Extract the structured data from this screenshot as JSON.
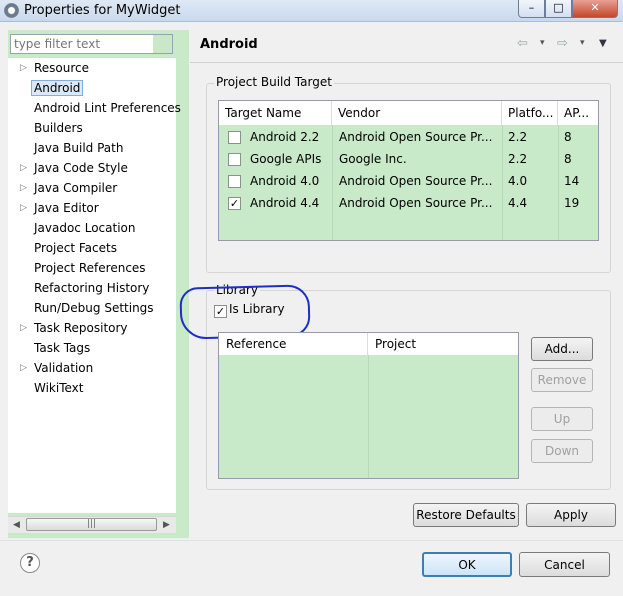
{
  "window": {
    "title": "Properties for MyWidget"
  },
  "filter": {
    "placeholder": "type filter text"
  },
  "tree": {
    "items": [
      {
        "label": "Resource",
        "expandable": true
      },
      {
        "label": "Android",
        "expandable": false,
        "selected": true
      },
      {
        "label": "Android Lint Preferences",
        "expandable": false
      },
      {
        "label": "Builders",
        "expandable": false
      },
      {
        "label": "Java Build Path",
        "expandable": false
      },
      {
        "label": "Java Code Style",
        "expandable": true
      },
      {
        "label": "Java Compiler",
        "expandable": true
      },
      {
        "label": "Java Editor",
        "expandable": true
      },
      {
        "label": "Javadoc Location",
        "expandable": false
      },
      {
        "label": "Project Facets",
        "expandable": false
      },
      {
        "label": "Project References",
        "expandable": false
      },
      {
        "label": "Refactoring History",
        "expandable": false
      },
      {
        "label": "Run/Debug Settings",
        "expandable": false
      },
      {
        "label": "Task Repository",
        "expandable": true
      },
      {
        "label": "Task Tags",
        "expandable": false
      },
      {
        "label": "Validation",
        "expandable": true
      },
      {
        "label": "WikiText",
        "expandable": false
      }
    ]
  },
  "page": {
    "title": "Android"
  },
  "build_target": {
    "group_title": "Project Build Target",
    "columns": [
      "Target Name",
      "Vendor",
      "Platfo...",
      "AP..."
    ],
    "rows": [
      {
        "checked": false,
        "name": "Android 2.2",
        "vendor": "Android Open Source Pr...",
        "platform": "2.2",
        "api": "8"
      },
      {
        "checked": false,
        "name": "Google APIs",
        "vendor": "Google Inc.",
        "platform": "2.2",
        "api": "8"
      },
      {
        "checked": false,
        "name": "Android 4.0",
        "vendor": "Android Open Source Pr...",
        "platform": "4.0",
        "api": "14"
      },
      {
        "checked": true,
        "name": "Android 4.4",
        "vendor": "Android Open Source Pr...",
        "platform": "4.4",
        "api": "19"
      }
    ]
  },
  "library": {
    "group_title": "Library",
    "is_library_label": "Is Library",
    "is_library_checked": true,
    "columns": [
      "Reference",
      "Project"
    ],
    "buttons": {
      "add": "Add...",
      "remove": "Remove",
      "up": "Up",
      "down": "Down"
    }
  },
  "actions": {
    "restore_defaults": "Restore Defaults",
    "apply": "Apply",
    "ok": "OK",
    "cancel": "Cancel"
  },
  "icons": {
    "check": "✓",
    "help": "?",
    "expand": "▷",
    "back": "⇦",
    "forward": "⇨",
    "dropdown": "▾"
  },
  "colors": {
    "table_bg": "#c9eac9",
    "annotation": "#1e2fc8",
    "selection": "#dbe8f9"
  }
}
